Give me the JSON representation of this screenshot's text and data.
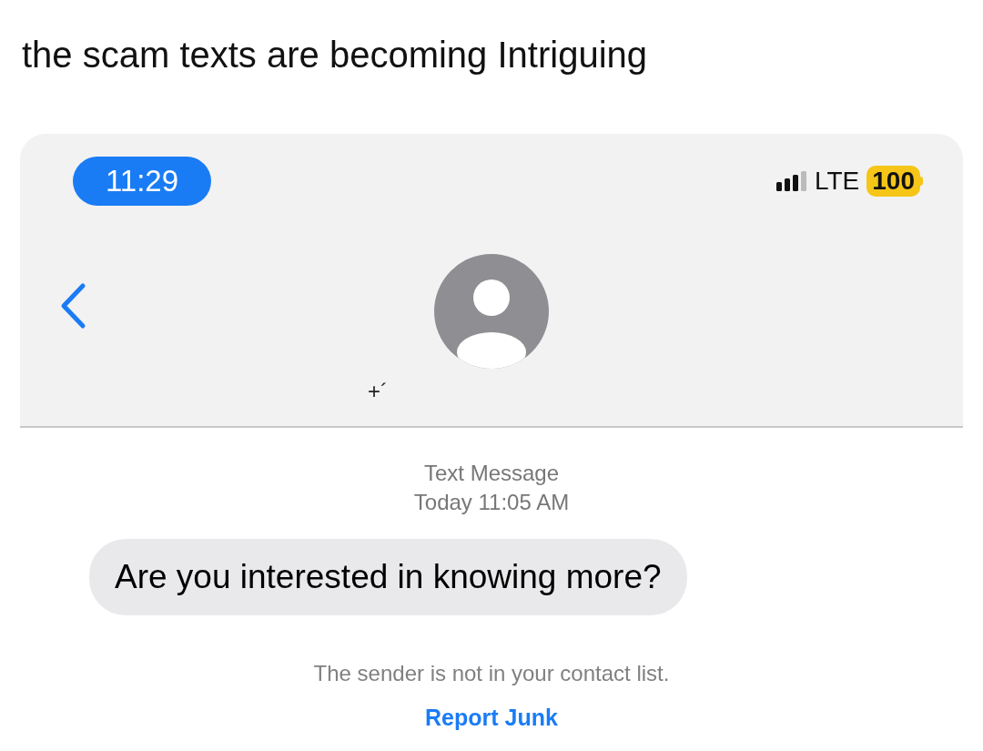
{
  "post": {
    "caption": "the scam texts are becoming Intriguing"
  },
  "status_bar": {
    "time": "11:29",
    "network": "LTE",
    "battery": "100"
  },
  "contact": {
    "number": "+´"
  },
  "thread": {
    "service": "Text Message",
    "timestamp": "Today 11:05 AM",
    "messages": [
      {
        "text": "Are you interested in knowing more?",
        "incoming": true
      }
    ],
    "notice": "The sender is not in your contact list.",
    "report_link": "Report Junk"
  }
}
